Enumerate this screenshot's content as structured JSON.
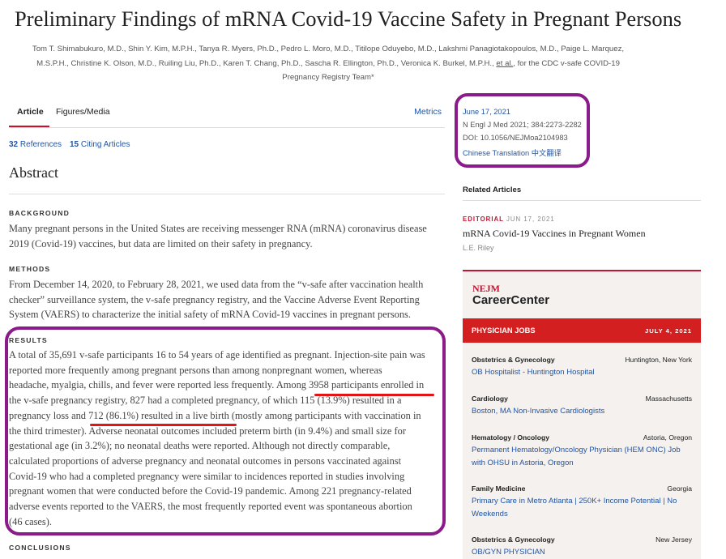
{
  "article": {
    "title": "Preliminary Findings of mRNA Covid-19 Vaccine Safety in Pregnant Persons",
    "authors_line1": "Tom T. Shimabukuro, M.D., Shin Y. Kim, M.P.H., Tanya R. Myers, Ph.D., Pedro L. Moro, M.D., Titilope Oduyebo, M.D., Lakshmi Panagiotakopoulos, M.D., Paige L. Marquez,",
    "authors_line2_pre": "M.S.P.H., Christine K. Olson, M.D., Ruiling Liu, Ph.D., Karen T. Chang, Ph.D., Sascha R. Ellington, Ph.D., Veronica K. Burkel, M.P.H., ",
    "authors_etal": "et al.",
    "authors_line2_post": ", for the CDC v-safe COVID-19",
    "authors_line3": "Pregnancy Registry Team*"
  },
  "tabs": {
    "article": "Article",
    "figures": "Figures/Media",
    "metrics": "Metrics"
  },
  "counts": {
    "references_num": "32",
    "references_label": "References",
    "citing_num": "15",
    "citing_label": "Citing Articles"
  },
  "abstract": {
    "heading": "Abstract",
    "background_label": "BACKGROUND",
    "background_l1": "Many pregnant persons in the United States are receiving messenger RNA (mRNA) coronavirus disease",
    "background_l2": "2019 (Covid-19) vaccines, but data are limited on their safety in pregnancy.",
    "methods_label": "METHODS",
    "methods_l1": "From December 14, 2020, to February 28, 2021, we used data from the “v-safe after vaccination health",
    "methods_l2": "checker” surveillance system, the v-safe pregnancy registry, and the Vaccine Adverse Event Reporting",
    "methods_l3": "System (VAERS) to characterize the initial safety of mRNA Covid-19 vaccines in pregnant persons.",
    "results_label": "RESULTS",
    "results_lines": [
      "A total of 35,691 v-safe participants 16 to 54 years of age identified as pregnant. Injection-site pain was",
      "reported more frequently among pregnant persons than among nonpregnant women, whereas",
      "headache, myalgia, chills, and fever were reported less frequently. Among 3958 participants enrolled in",
      "the v-safe pregnancy registry, 827 had a completed pregnancy, of which 115 (13.9%) resulted in a",
      "pregnancy loss and 712 (86.1%) resulted in a live birth (mostly among participants with vaccination in",
      "the third trimester). Adverse neonatal outcomes included preterm birth (in 9.4%) and small size for",
      "gestational age (in 3.2%); no neonatal deaths were reported. Although not directly comparable,",
      "calculated proportions of adverse pregnancy and neonatal outcomes in persons vaccinated against",
      "Covid-19 who had a completed pregnancy were similar to incidences reported in studies involving",
      "pregnant women that were conducted before the Covid-19 pandemic. Among 221 pregnancy-related",
      "adverse events reported to the VAERS, the most frequently reported event was spontaneous abortion",
      "(46 cases)."
    ],
    "conclusions_label": "CONCLUSIONS"
  },
  "publication": {
    "date": "June 17, 2021",
    "citation": "N Engl J Med 2021; 384:2273-2282",
    "doi": "DOI: 10.1056/NEJMoa2104983",
    "translation": "Chinese Translation 中文翻译"
  },
  "related": {
    "heading": "Related Articles",
    "tag": "EDITORIAL",
    "date": "JUN 17, 2021",
    "title": "mRNA Covid-19 Vaccines in Pregnant Women",
    "author": "L.E. Riley"
  },
  "career": {
    "brand_mark": "NEJM",
    "brand_name": "CareerCenter",
    "jobs_label": "PHYSICIAN JOBS",
    "jobs_date": "JULY 4, 2021",
    "jobs": [
      {
        "specialty": "Obstetrics & Gynecology",
        "location": "Huntington, New York",
        "title": "OB Hospitalist - Huntington Hospital"
      },
      {
        "specialty": "Cardiology",
        "location": "Massachusetts",
        "title": "Boston, MA Non-Invasive Cardiologists"
      },
      {
        "specialty": "Hematology / Oncology",
        "location": "Astoria, Oregon",
        "title": "Permanent Hematology/Oncology Physician (HEM ONC) Job with OHSU in Astoria, Oregon"
      },
      {
        "specialty": "Family Medicine",
        "location": "Georgia",
        "title": "Primary Care in Metro Atlanta | 250K+ Income Potential | No Weekends"
      },
      {
        "specialty": "Obstetrics & Gynecology",
        "location": "New Jersey",
        "title": "OB/GYN PHYSICIAN"
      }
    ]
  },
  "colors": {
    "annotation_box": "#8b1a8b",
    "annotation_underline": "#e31414",
    "link": "#2155a6",
    "brand_red": "#c41230"
  }
}
